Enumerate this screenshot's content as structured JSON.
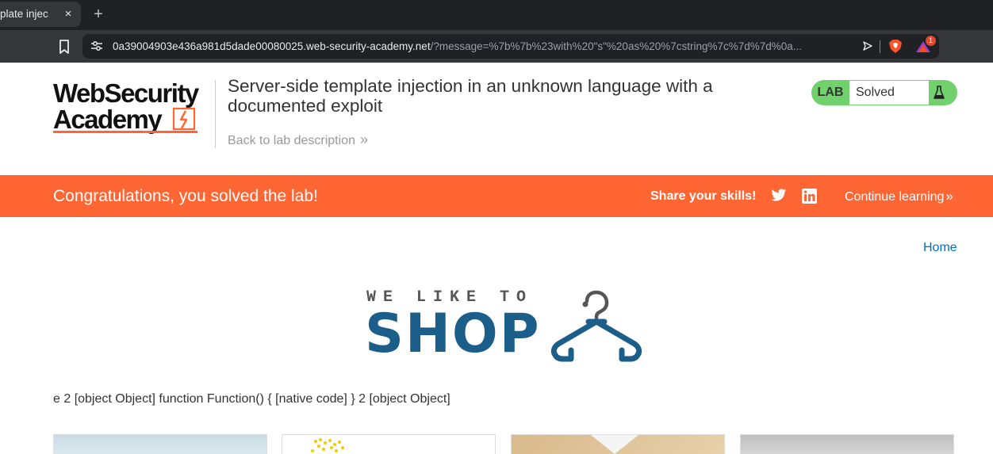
{
  "browser": {
    "tab_title": "plate injec",
    "tab_close": "×",
    "new_tab": "+",
    "url_host": "0a39004903e436a981d5dade00080025.web-security-academy.net",
    "url_path": "/?message=%7b%7b%23with%20\"s\"%20as%20%7cstring%7c%7d%7d%0a...",
    "rewards_badge": "1"
  },
  "academy": {
    "logo_line1": "WebSecurity",
    "logo_line2": "Academy",
    "lab_title": "Server-side template injection in an unknown language with a documented exploit",
    "back_link": "Back to lab description",
    "back_chevron": "»",
    "lab_tag": "LAB",
    "lab_state": "Solved"
  },
  "banner": {
    "message": "Congratulations, you solved the lab!",
    "share_label": "Share your skills!",
    "continue_label": "Continue learning",
    "continue_chevron": "»",
    "color": "#ff6633"
  },
  "shop": {
    "home_link": "Home",
    "tagline": "WE LIKE TO",
    "word": "SHOP",
    "template_output": "e 2 [object Object] function Function() { [native code] } 2 [object Object]",
    "brand_color": "#1b5e8a"
  }
}
